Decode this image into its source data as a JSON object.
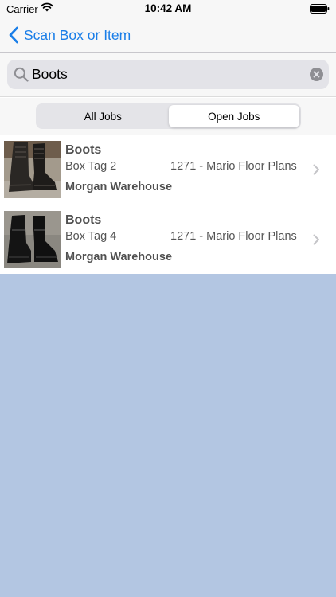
{
  "status_bar": {
    "carrier": "Carrier",
    "time": "10:42 AM",
    "wifi_icon": "wifi-icon",
    "battery_icon": "battery-full-icon"
  },
  "nav": {
    "back_label": "Scan Box or Item",
    "back_icon": "chevron-left-icon"
  },
  "search": {
    "value": "Boots",
    "placeholder": "Search",
    "search_icon": "magnifier-icon",
    "clear_icon": "clear-circle-icon"
  },
  "segments": {
    "items": [
      "All Jobs",
      "Open Jobs"
    ],
    "selected": "Open Jobs"
  },
  "results": [
    {
      "title": "Boots",
      "box_tag": "Box Tag 2",
      "job": "1271 - Mario Floor Plans",
      "location": "Morgan Warehouse"
    },
    {
      "title": "Boots",
      "box_tag": "Box Tag 4",
      "job": "1271 - Mario Floor Plans",
      "location": "Morgan Warehouse"
    }
  ],
  "colors": {
    "accent": "#1a7ee8",
    "empty_background": "#b3c6e2"
  }
}
